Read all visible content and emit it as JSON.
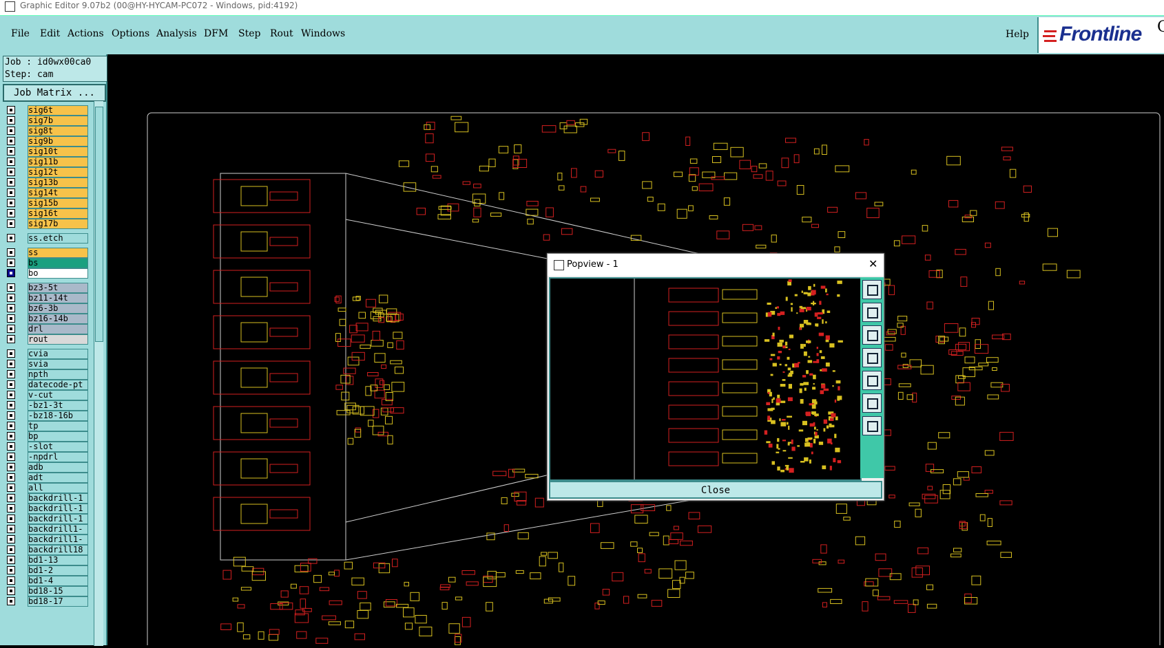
{
  "window": {
    "title": "Graphic Editor 9.07b2 (00@HY-HYCAM-PC072 - Windows, pid:4192)"
  },
  "menu": {
    "items": [
      "File",
      "Edit",
      "Actions",
      "Options",
      "Analysis",
      "DFM",
      "Step",
      "Rout",
      "Windows"
    ],
    "help": "Help"
  },
  "logo": {
    "text": "Frontline",
    "trail": "G"
  },
  "job": {
    "job_line": "Job : id0wx00ca0",
    "step_line": "Step: cam",
    "matrix_label": "Job Matrix ..."
  },
  "layers": [
    {
      "name": "sig6t",
      "color": "#f7c24a"
    },
    {
      "name": "sig7b",
      "color": "#f7c24a"
    },
    {
      "name": "sig8t",
      "color": "#f7c24a"
    },
    {
      "name": "sig9b",
      "color": "#f7c24a"
    },
    {
      "name": "sig10t",
      "color": "#f7c24a"
    },
    {
      "name": "sig11b",
      "color": "#f7c24a"
    },
    {
      "name": "sig12t",
      "color": "#f7c24a"
    },
    {
      "name": "sig13b",
      "color": "#f7c24a"
    },
    {
      "name": "sig14t",
      "color": "#f7c24a"
    },
    {
      "name": "sig15b",
      "color": "#f7c24a"
    },
    {
      "name": "sig16t",
      "color": "#f7c24a"
    },
    {
      "name": "sig17b",
      "color": "#f7c24a"
    },
    {
      "name": "ss.etch",
      "color": "#9fdcdc"
    },
    {
      "name": "ss",
      "color": "#f7c24a"
    },
    {
      "name": "bs",
      "color": "#1aa080"
    },
    {
      "name": "bo",
      "color": "#ffffff",
      "active": true
    },
    {
      "name": "bz3-5t",
      "color": "#a9b9c9"
    },
    {
      "name": "bz11-14t",
      "color": "#a9b9c9"
    },
    {
      "name": "bz6-3b",
      "color": "#a9b9c9"
    },
    {
      "name": "bz16-14b",
      "color": "#a9b9c9"
    },
    {
      "name": "drl",
      "color": "#a9b9c9"
    },
    {
      "name": "rout",
      "color": "#d9d9d9"
    },
    {
      "name": "cvia",
      "color": "#9fdcdc"
    },
    {
      "name": "svia",
      "color": "#9fdcdc"
    },
    {
      "name": "npth",
      "color": "#9fdcdc"
    },
    {
      "name": "datecode-pt",
      "color": "#9fdcdc"
    },
    {
      "name": "v-cut",
      "color": "#9fdcdc"
    },
    {
      "name": "-bz1-3t",
      "color": "#9fdcdc"
    },
    {
      "name": "-bz18-16b",
      "color": "#9fdcdc"
    },
    {
      "name": "tp",
      "color": "#9fdcdc"
    },
    {
      "name": "bp",
      "color": "#9fdcdc"
    },
    {
      "name": "-slot",
      "color": "#9fdcdc"
    },
    {
      "name": "-npdrl",
      "color": "#9fdcdc"
    },
    {
      "name": "adb",
      "color": "#9fdcdc"
    },
    {
      "name": "adt",
      "color": "#9fdcdc"
    },
    {
      "name": "all",
      "color": "#9fdcdc"
    },
    {
      "name": "backdrill-1",
      "color": "#9fdcdc"
    },
    {
      "name": "backdrill-1",
      "color": "#9fdcdc"
    },
    {
      "name": "backdrill-1",
      "color": "#9fdcdc"
    },
    {
      "name": "backdrill1-",
      "color": "#9fdcdc"
    },
    {
      "name": "backdrill1-",
      "color": "#9fdcdc"
    },
    {
      "name": "backdrill18",
      "color": "#9fdcdc"
    },
    {
      "name": "bd1-13",
      "color": "#9fdcdc"
    },
    {
      "name": "bd1-2",
      "color": "#9fdcdc"
    },
    {
      "name": "bd1-4",
      "color": "#9fdcdc"
    },
    {
      "name": "bd18-15",
      "color": "#9fdcdc"
    },
    {
      "name": "bd18-17",
      "color": "#9fdcdc"
    }
  ],
  "popview": {
    "title": "Popview - 1",
    "close_label": "Close",
    "close_x": "✕"
  },
  "colors": {
    "panel": "#9fdcdc",
    "trace_red": "#d42020",
    "trace_yellow": "#d8c020",
    "outline": "#d0d0d0"
  }
}
